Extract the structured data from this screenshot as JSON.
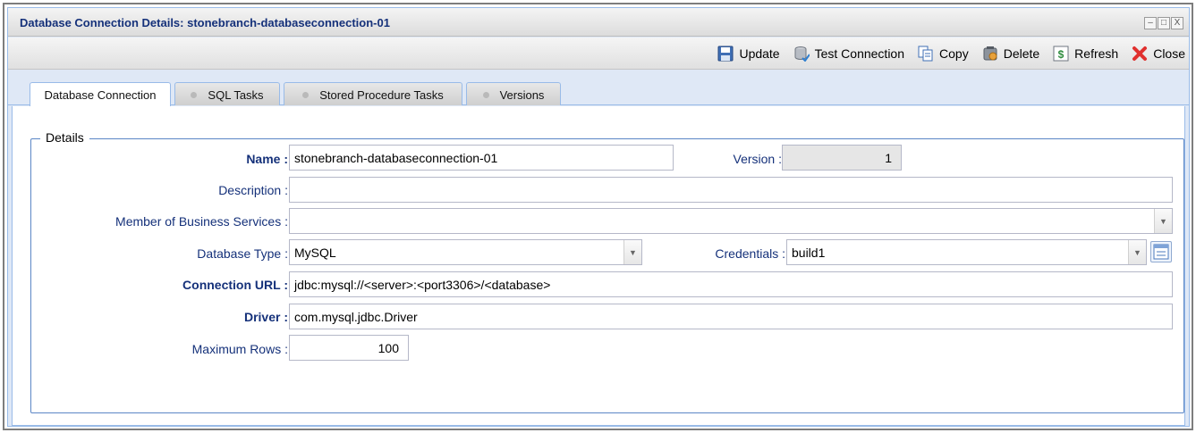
{
  "window": {
    "title": "Database Connection Details: stonebranch-databaseconnection-01",
    "minimize_glyph": "–",
    "maximize_glyph": "□",
    "close_glyph": "X"
  },
  "toolbar": {
    "buttons": [
      {
        "label": "Update",
        "icon": "save-icon"
      },
      {
        "label": "Test Connection",
        "icon": "database-test-icon"
      },
      {
        "label": "Copy",
        "icon": "copy-icon"
      },
      {
        "label": "Delete",
        "icon": "delete-icon"
      },
      {
        "label": "Refresh",
        "icon": "refresh-icon"
      },
      {
        "label": "Close",
        "icon": "close-icon",
        "color": "#e0302e"
      }
    ]
  },
  "tabs": [
    {
      "label": "Database Connection",
      "active": true
    },
    {
      "label": "SQL Tasks",
      "active": false
    },
    {
      "label": "Stored Procedure Tasks",
      "active": false
    },
    {
      "label": "Versions",
      "active": false
    }
  ],
  "details": {
    "legend": "Details",
    "fields": {
      "name": {
        "label": "Name :",
        "value": "stonebranch-databaseconnection-01"
      },
      "version": {
        "label": "Version :",
        "value": "1"
      },
      "description": {
        "label": "Description :",
        "value": ""
      },
      "business_services": {
        "label": "Member of Business Services :",
        "value": ""
      },
      "database_type": {
        "label": "Database Type :",
        "value": "MySQL"
      },
      "credentials": {
        "label": "Credentials :",
        "value": "build1"
      },
      "connection_url": {
        "label": "Connection URL :",
        "value": "jdbc:mysql://<server>:<port3306>/<database>"
      },
      "driver": {
        "label": "Driver :",
        "value": "com.mysql.jdbc.Driver"
      },
      "max_rows": {
        "label": "Maximum Rows :",
        "value": "100"
      }
    }
  },
  "colors": {
    "label_text": "#15317a",
    "border_blue": "#99bbe8",
    "fieldset_border": "#5b86c6"
  }
}
